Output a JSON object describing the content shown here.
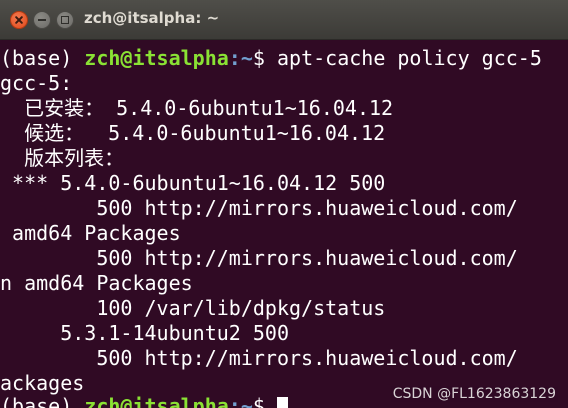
{
  "window": {
    "title": "zch@itsalpha: ~"
  },
  "terminal": {
    "prompt": {
      "env": "(base) ",
      "user_host": "zch@itsalpha",
      "path": ":~",
      "symbol": "$ "
    },
    "command": "apt-cache policy gcc-5",
    "output": [
      "gcc-5:",
      "  已安装： 5.4.0-6ubuntu1~16.04.12",
      "  候选：  5.4.0-6ubuntu1~16.04.12",
      "  版本列表：",
      " *** 5.4.0-6ubuntu1~16.04.12 500",
      "        500 http://mirrors.huaweicloud.com/",
      " amd64 Packages",
      "        500 http://mirrors.huaweicloud.com/",
      "n amd64 Packages",
      "        100 /var/lib/dpkg/status",
      "     5.3.1-14ubuntu2 500",
      "        500 http://mirrors.huaweicloud.com/",
      "ackages"
    ],
    "last_prompt": {
      "env": "(base) ",
      "user_host": "zch@itsalpha",
      "path": ":~",
      "symbol": "$ "
    }
  },
  "watermark": "CSDN @FL1623863129",
  "colors": {
    "background": "#300a24",
    "user_host": "#8ae234",
    "path": "#729fcf",
    "text": "#ffffff"
  }
}
